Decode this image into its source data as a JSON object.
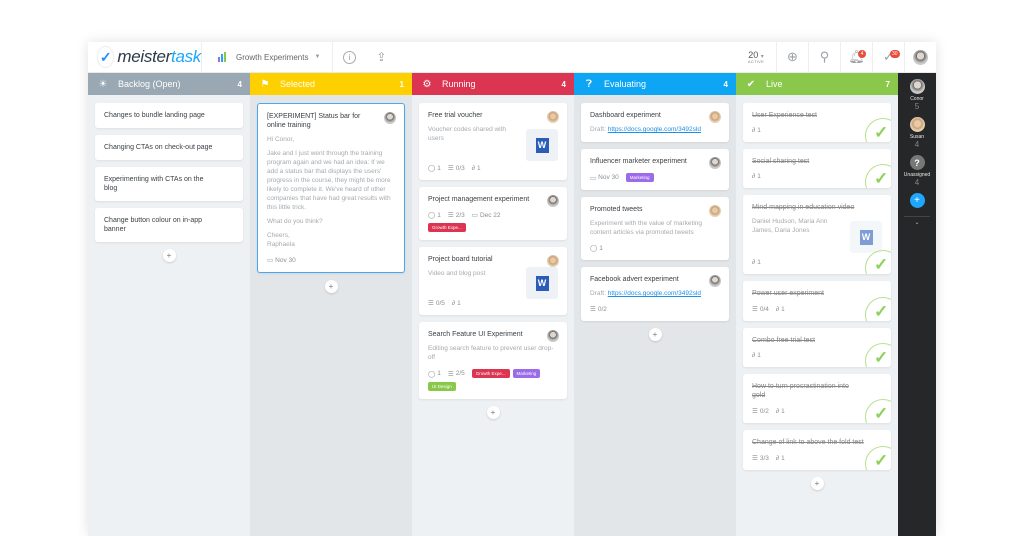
{
  "app": {
    "logo_main": "meister",
    "logo_accent": "task"
  },
  "topbar": {
    "project_name": "Growth Experiments",
    "active_count": "20",
    "active_label": "ACTIVE",
    "notifications_badge": "4",
    "checklist_badge": "30"
  },
  "colors": {
    "backlog": "#99a8b2",
    "selected": "#ffd000",
    "running": "#db3552",
    "evaluating": "#0ea5f5",
    "live": "#89c84b",
    "tag_growth": "#db3552",
    "tag_marketing": "#9b6cea",
    "tag_ui": "#89c84b"
  },
  "columns": [
    {
      "title": "Backlog (Open)",
      "count": "4",
      "icon": "lightbulb-icon",
      "cards": [
        {
          "title": "Changes to bundle landing page"
        },
        {
          "title": "Changing CTAs on check-out page"
        },
        {
          "title": "Experimenting with CTAs on the blog"
        },
        {
          "title": "Change button colour on in-app banner"
        }
      ]
    },
    {
      "title": "Selected",
      "count": "1",
      "icon": "signpost-icon",
      "cards": [
        {
          "title": "[EXPERIMENT] Status bar for online training",
          "greeting": "Hi Conor,",
          "body": "Jake and I just went through the training program again and we had an idea: If we add a status bar that displays the users' progress in the course, they might be more likely to complete it. We've heard of other companies that have had great results with this little trick.",
          "question": "What do you think?",
          "signoff": "Cheers,",
          "signature": "Raphaela",
          "due": "Nov 30"
        }
      ]
    },
    {
      "title": "Running",
      "count": "4",
      "icon": "gear-icon",
      "cards": [
        {
          "title": "Free trial voucher",
          "desc": "Voucher codes shared with users",
          "comments": "1",
          "checklist": "0/3",
          "attachments": "1"
        },
        {
          "title": "Project management experiment",
          "comments": "1",
          "checklist": "2/3",
          "due": "Dec 22",
          "tag": "Growth Expe..."
        },
        {
          "title": "Project board tutorial",
          "desc": "Video and blog post",
          "checklist": "0/5",
          "attachments": "1"
        },
        {
          "title": "Search Feature UI Experiment",
          "desc": "Editing search feature to prevent user drop-off",
          "comments": "1",
          "checklist": "2/5",
          "tags": [
            "Growth Expe...",
            "Marketing",
            "UI Design"
          ]
        }
      ]
    },
    {
      "title": "Evaluating",
      "count": "4",
      "icon": "question-icon",
      "cards": [
        {
          "title": "Dashboard experiment",
          "draft_label": "Draft:",
          "link": "https://docs.google.com/3492sld"
        },
        {
          "title": "Influencer marketer experiment",
          "due": "Nov 30",
          "tag": "Marketing"
        },
        {
          "title": "Promoted tweets",
          "desc": "Experiment with the value of marketing content articles via promoted tweets",
          "comments": "1"
        },
        {
          "title": "Facebook advert experiment",
          "draft_label": "Draft:",
          "link": "https://docs.google.com/3492sld",
          "checklist": "0/2"
        }
      ]
    },
    {
      "title": "Live",
      "count": "7",
      "icon": "check-circle-icon",
      "cards": [
        {
          "title": "User Experience test",
          "attachments": "1"
        },
        {
          "title": "Social sharing test",
          "attachments": "1"
        },
        {
          "title": "Mind mapping in education video",
          "desc": "Daniel Hudson, Maria Ann James, Daria Jones",
          "attachments": "1"
        },
        {
          "title": "Power user experiment",
          "checklist": "0/4",
          "attachments": "1"
        },
        {
          "title": "Combo free trial test",
          "attachments": "1"
        },
        {
          "title": "How to turn procrastination into gold",
          "checklist": "0/2",
          "attachments": "1"
        },
        {
          "title": "Change of link to above the fold test",
          "checklist": "3/3",
          "attachments": "1"
        }
      ]
    }
  ],
  "people": [
    {
      "name": "Conor",
      "count": "5"
    },
    {
      "name": "Susan",
      "count": "4"
    },
    {
      "name": "Unassigned",
      "count": "4"
    }
  ],
  "icons": {
    "add": "+",
    "chevron": "⌄",
    "comment": "◯",
    "checklist": "☰",
    "attachment": "∂",
    "calendar": "▭",
    "word": "W"
  }
}
